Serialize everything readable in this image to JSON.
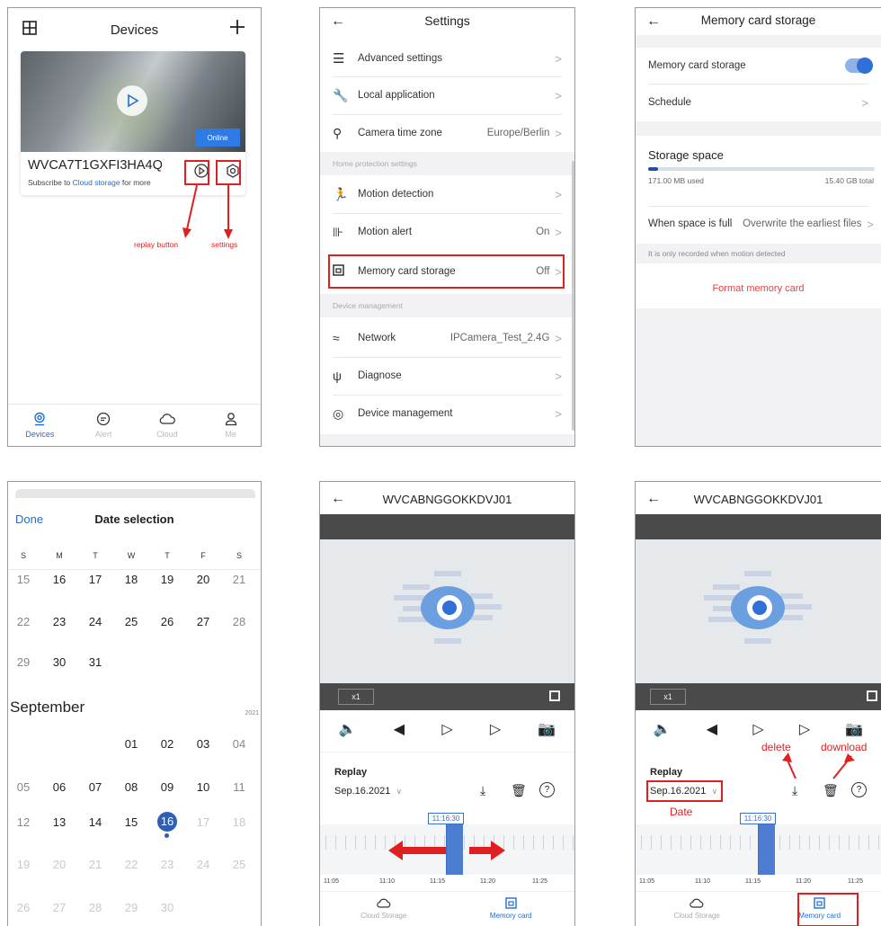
{
  "colors": {
    "accent": "#1e6fd0",
    "annotation": "#e02020",
    "bar": "#4a4a4a"
  },
  "devices": {
    "title": "Devices",
    "online": "Online",
    "device_name": "WVCA7T1GXFI3HA4Q",
    "subscribe_prefix": "Subscribe to",
    "subscribe_link": "Cloud storage",
    "subscribe_suffix": "for more",
    "annot_replay": "replay button",
    "annot_settings": "settings",
    "nav": [
      {
        "label": "Devices",
        "icon": "camera-icon"
      },
      {
        "label": "Alert",
        "icon": "chat-icon"
      },
      {
        "label": "Cloud",
        "icon": "cloud-icon"
      },
      {
        "label": "Me",
        "icon": "person-icon"
      }
    ]
  },
  "settings": {
    "title": "Settings",
    "items": [
      {
        "label": "Advanced settings",
        "value": "",
        "icon": "sliders-icon"
      },
      {
        "label": "Local application",
        "value": "",
        "icon": "wrench-icon"
      },
      {
        "label": "Camera time zone",
        "value": "Europe/Berlin",
        "icon": "pin-icon"
      },
      {
        "label": "Motion detection",
        "value": "",
        "icon": "running-icon"
      },
      {
        "label": "Motion alert",
        "value": "On",
        "icon": "alarm-icon"
      },
      {
        "label": "Memory card storage",
        "value": "Off",
        "icon": "sdcard-icon"
      },
      {
        "label": "Network",
        "value": "IPCamera_Test_2.4G",
        "icon": "wifi-icon"
      },
      {
        "label": "Diagnose",
        "value": "",
        "icon": "stethoscope-icon"
      },
      {
        "label": "Device management",
        "value": "",
        "icon": "device-icon"
      }
    ],
    "section_home": "Home protection settings",
    "section_device": "Device management"
  },
  "memory": {
    "title": "Memory card storage",
    "toggle_label": "Memory card storage",
    "schedule": "Schedule",
    "storage_space": "Storage space",
    "used": "171.00 MB used",
    "total": "15.40 GB total",
    "used_fraction": 0.045,
    "when_full_label": "When space is full",
    "when_full_value": "Overwrite the earliest files",
    "note": "It is only recorded when motion detected",
    "format": "Format memory card"
  },
  "calendar": {
    "done": "Done",
    "title": "Date selection",
    "weekdays": [
      "S",
      "M",
      "T",
      "W",
      "T",
      "F",
      "S"
    ],
    "aug_rows": [
      [
        "15",
        "16",
        "17",
        "18",
        "19",
        "20",
        "21"
      ],
      [
        "22",
        "23",
        "24",
        "25",
        "26",
        "27",
        "28"
      ],
      [
        "29",
        "30",
        "31",
        "",
        "",
        "",
        ""
      ]
    ],
    "month": "September",
    "year": "2021",
    "sep_rows": [
      [
        "",
        "",
        "",
        "01",
        "02",
        "03",
        "04"
      ],
      [
        "05",
        "06",
        "07",
        "08",
        "09",
        "10",
        "11"
      ],
      [
        "12",
        "13",
        "14",
        "15",
        "16",
        "17",
        "18"
      ],
      [
        "19",
        "20",
        "21",
        "22",
        "23",
        "24",
        "25"
      ],
      [
        "26",
        "27",
        "28",
        "29",
        "30",
        "",
        ""
      ]
    ],
    "selected": "16"
  },
  "replay": {
    "device": "WVCABNGGOKKDVJ01",
    "speed": "x1",
    "replay_label": "Replay",
    "date": "Sep.16.2021",
    "time_marker": "11:16:30",
    "times": [
      "11:05",
      "11:10",
      "11:15",
      "11:20",
      "11:25"
    ],
    "tab_cloud": "Cloud Storage",
    "tab_memory": "Memory card",
    "annot_delete": "delete",
    "annot_download": "download",
    "annot_date": "Date"
  }
}
